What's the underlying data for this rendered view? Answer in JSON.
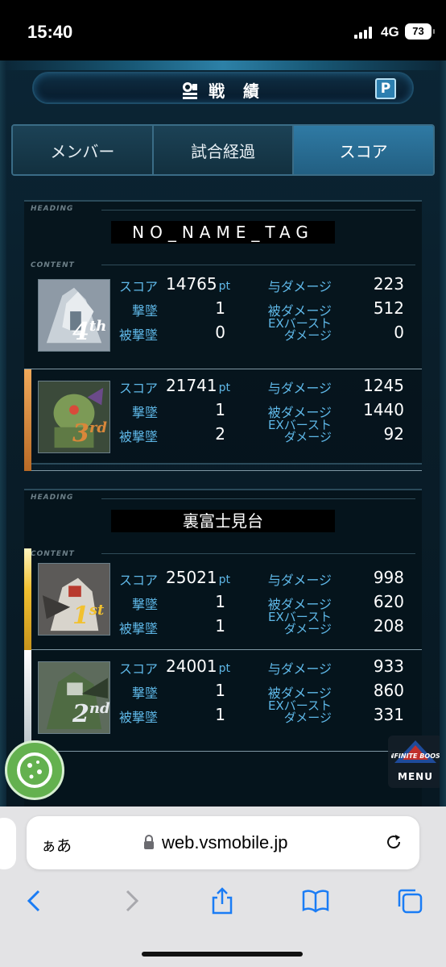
{
  "status_bar": {
    "time": "15:40",
    "network": "4G",
    "battery": "73"
  },
  "header": {
    "title": "戦 績",
    "help_label": "P"
  },
  "tabs": [
    {
      "label": "メンバー",
      "active": false
    },
    {
      "label": "試合経過",
      "active": false
    },
    {
      "label": "スコア",
      "active": true
    }
  ],
  "labels": {
    "heading": "HEADING",
    "content": "CONTENT",
    "score": "スコア",
    "kills": "撃墜",
    "deaths": "被撃墜",
    "dealt": "与ダメージ",
    "taken": "被ダメージ",
    "ex_burst_line1": "EXバースト",
    "ex_burst_line2": "ダメージ",
    "pt_unit": "pt"
  },
  "teams": [
    {
      "name": "NO_NAME_TAG",
      "players": [
        {
          "rank_num": "4",
          "rank_suffix": "th",
          "rank_color": "#ffffff",
          "score": "14765",
          "kills": "1",
          "deaths": "0",
          "dealt": "223",
          "taken": "512",
          "ex_burst": "0"
        },
        {
          "rank_num": "3",
          "rank_suffix": "rd",
          "rank_color": "#d9873a",
          "score": "21741",
          "kills": "1",
          "deaths": "2",
          "dealt": "1245",
          "taken": "1440",
          "ex_burst": "92"
        }
      ]
    },
    {
      "name": "裏富士見台",
      "players": [
        {
          "rank_num": "1",
          "rank_suffix": "st",
          "rank_color": "#f2c12e",
          "score": "25021",
          "kills": "1",
          "deaths": "1",
          "dealt": "998",
          "taken": "620",
          "ex_burst": "208"
        },
        {
          "rank_num": "2",
          "rank_suffix": "nd",
          "rank_color": "#e5e9ec",
          "score": "24001",
          "kills": "1",
          "deaths": "1",
          "dealt": "933",
          "taken": "860",
          "ex_burst": "331"
        }
      ]
    }
  ],
  "menu_button": {
    "logo_text": "INFINITE BOOST",
    "label": "MENU"
  },
  "browser": {
    "aa_label": "ぁあ",
    "url": "web.vsmobile.jp"
  },
  "colors": {
    "accent": "#5fb8e8",
    "active_tab": "#2f7aa4",
    "cookie": "#64b14f",
    "ios_blue": "#1a7cf5"
  }
}
